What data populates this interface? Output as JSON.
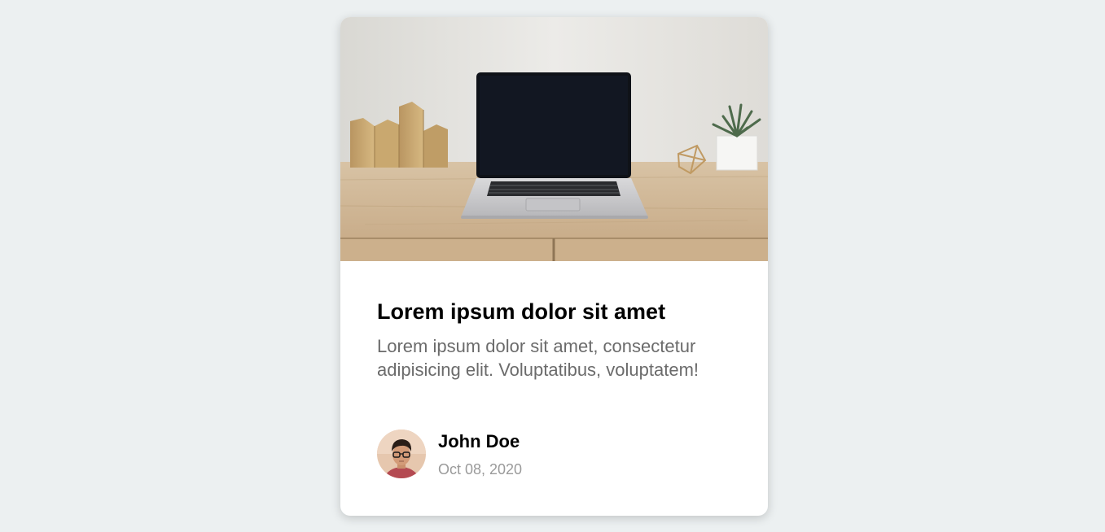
{
  "card": {
    "title": "Lorem ipsum dolor sit amet",
    "text": "Lorem ipsum dolor sit amet, consectetur adipisicing elit. Voluptatibus, voluptatem!",
    "image_icon": "laptop-desk-photo",
    "author": {
      "name": "John Doe",
      "date": "Oct 08, 2020",
      "avatar_icon": "avatar-photo"
    }
  },
  "colors": {
    "page_background": "#ecf0f1",
    "card_background": "#ffffff",
    "title": "#000000",
    "text": "#6b6b6b",
    "date": "#9a9a9a"
  }
}
